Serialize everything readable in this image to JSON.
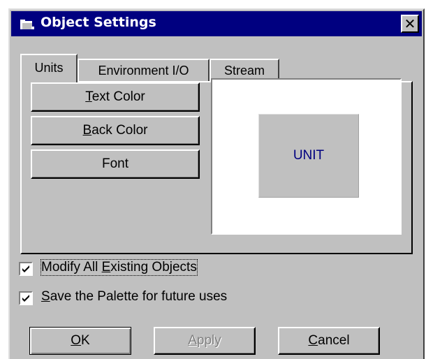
{
  "window": {
    "title": "Object Settings",
    "close_glyph": "✕",
    "icon": "folder-app-icon"
  },
  "tabs": [
    {
      "label": "Units",
      "active": true
    },
    {
      "label": "Environment I/O",
      "active": false
    },
    {
      "label": "Stream",
      "active": false
    }
  ],
  "units_tab": {
    "text_color": {
      "mnemonic": "T",
      "rest": "ext Color"
    },
    "back_color": {
      "mnemonic": "B",
      "rest": "ack Color"
    },
    "font_label": "Font",
    "preview_text": "UNIT"
  },
  "options": {
    "modify_all": {
      "before": "Modify All ",
      "mnemonic": "E",
      "after": "xisting Objects",
      "checked": true
    },
    "save_palette": {
      "before": "",
      "mnemonic": "S",
      "after": "ave the Palette for future uses",
      "checked": true
    }
  },
  "footer": {
    "ok": {
      "mnemonic": "O",
      "rest": "K"
    },
    "apply": {
      "mnemonic": "A",
      "rest": "pply",
      "disabled": true
    },
    "cancel": {
      "mnemonic": "C",
      "rest": "ancel"
    }
  },
  "colors": {
    "titlebar": "#000080",
    "face": "#c0c0c0",
    "preview_text": "#000080"
  }
}
